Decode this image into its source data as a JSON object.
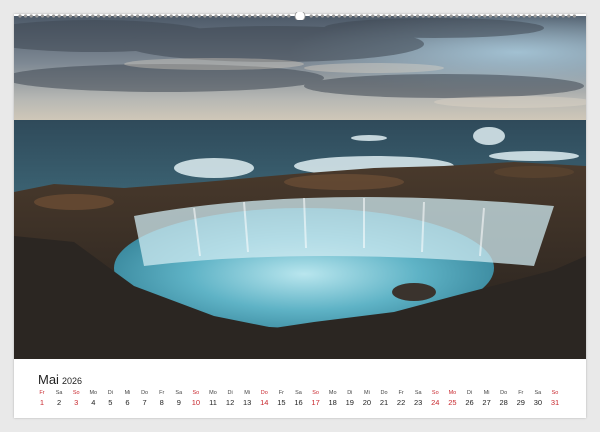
{
  "calendar": {
    "month": "Mai",
    "year": "2026",
    "days": [
      {
        "dow": "Fr",
        "num": "1",
        "red": true
      },
      {
        "dow": "Sa",
        "num": "2",
        "red": false
      },
      {
        "dow": "So",
        "num": "3",
        "red": true
      },
      {
        "dow": "Mo",
        "num": "4",
        "red": false
      },
      {
        "dow": "Di",
        "num": "5",
        "red": false
      },
      {
        "dow": "Mi",
        "num": "6",
        "red": false
      },
      {
        "dow": "Do",
        "num": "7",
        "red": false
      },
      {
        "dow": "Fr",
        "num": "8",
        "red": false
      },
      {
        "dow": "Sa",
        "num": "9",
        "red": false
      },
      {
        "dow": "So",
        "num": "10",
        "red": true
      },
      {
        "dow": "Mo",
        "num": "11",
        "red": false
      },
      {
        "dow": "Di",
        "num": "12",
        "red": false
      },
      {
        "dow": "Mi",
        "num": "13",
        "red": false
      },
      {
        "dow": "Do",
        "num": "14",
        "red": true
      },
      {
        "dow": "Fr",
        "num": "15",
        "red": false
      },
      {
        "dow": "Sa",
        "num": "16",
        "red": false
      },
      {
        "dow": "So",
        "num": "17",
        "red": true
      },
      {
        "dow": "Mo",
        "num": "18",
        "red": false
      },
      {
        "dow": "Di",
        "num": "19",
        "red": false
      },
      {
        "dow": "Mi",
        "num": "20",
        "red": false
      },
      {
        "dow": "Do",
        "num": "21",
        "red": false
      },
      {
        "dow": "Fr",
        "num": "22",
        "red": false
      },
      {
        "dow": "Sa",
        "num": "23",
        "red": false
      },
      {
        "dow": "So",
        "num": "24",
        "red": true
      },
      {
        "dow": "Mo",
        "num": "25",
        "red": true
      },
      {
        "dow": "Di",
        "num": "26",
        "red": false
      },
      {
        "dow": "Mi",
        "num": "27",
        "red": false
      },
      {
        "dow": "Do",
        "num": "28",
        "red": false
      },
      {
        "dow": "Fr",
        "num": "29",
        "red": false
      },
      {
        "dow": "Sa",
        "num": "30",
        "red": false
      },
      {
        "dow": "So",
        "num": "31",
        "red": true
      }
    ]
  },
  "colors": {
    "holiday_red": "#c8282e",
    "text_dark": "#222222"
  }
}
